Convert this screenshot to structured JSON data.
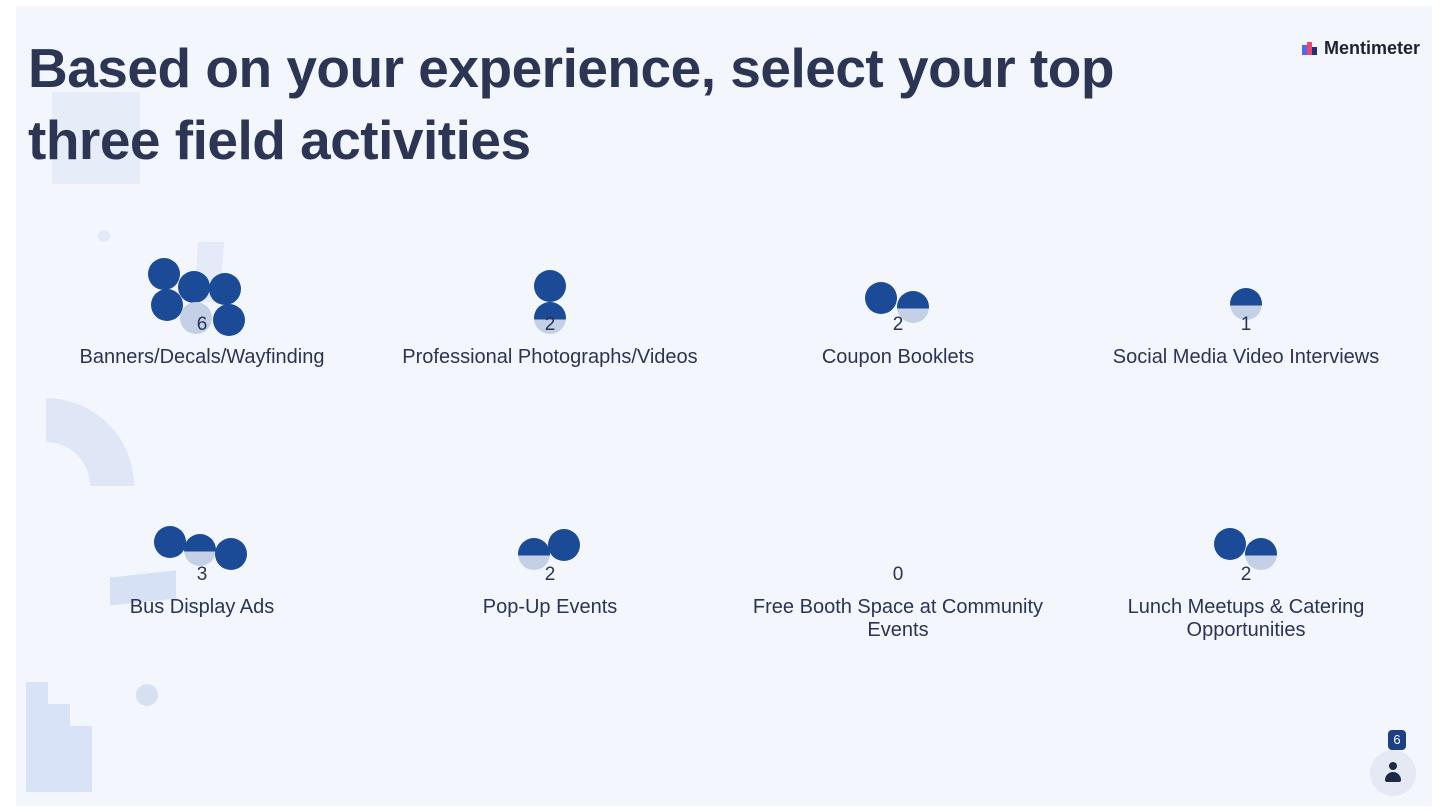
{
  "title": "Based on your experience, select your top three field activities",
  "brand": {
    "name": "Mentimeter"
  },
  "options": [
    {
      "label": "Banners/Decals/Wayfinding",
      "count": "6"
    },
    {
      "label": "Professional Photographs/Videos",
      "count": "2"
    },
    {
      "label": "Coupon Booklets",
      "count": "2"
    },
    {
      "label": "Social Media Video Interviews",
      "count": "1"
    },
    {
      "label": "Bus Display Ads",
      "count": "3"
    },
    {
      "label": "Pop-Up Events",
      "count": "2"
    },
    {
      "label": "Free Booth Space at Community Events",
      "count": "0"
    },
    {
      "label": "Lunch Meetups & Catering Opportunities",
      "count": "2"
    }
  ],
  "responses": {
    "count": "6",
    "icon": "person-icon"
  },
  "colors": {
    "dot": "#1b4a97",
    "text": "#2a3454",
    "background": "#f3f6fd"
  }
}
